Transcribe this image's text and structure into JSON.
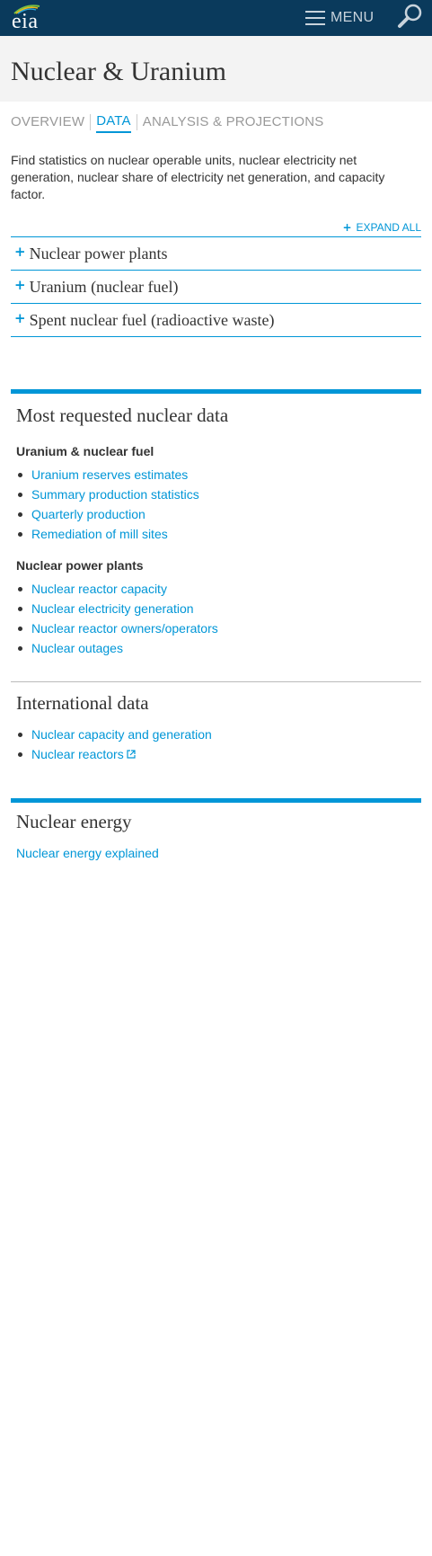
{
  "header": {
    "logo_text": "eia",
    "menu_label": "MENU",
    "search_icon": "search-icon",
    "menu_icon": "hamburger-icon",
    "colors": {
      "bar": "#0a3a5c",
      "accent": "#0096d7"
    }
  },
  "page": {
    "title": "Nuclear & Uranium"
  },
  "tabs": [
    {
      "label": "OVERVIEW",
      "active": false
    },
    {
      "label": "DATA",
      "active": true
    },
    {
      "label": "ANALYSIS & PROJECTIONS",
      "active": false
    }
  ],
  "intro": "Find statistics on nuclear operable units, nuclear electricity net generation, nuclear share of electricity net generation, and capacity factor.",
  "expand_all": "EXPAND ALL",
  "accordion": [
    {
      "label": "Nuclear power plants"
    },
    {
      "label": "Uranium (nuclear fuel)"
    },
    {
      "label": "Spent nuclear fuel (radioactive waste)"
    }
  ],
  "most_requested": {
    "title": "Most requested nuclear data",
    "groups": [
      {
        "heading": "Uranium & nuclear fuel",
        "links": [
          "Uranium reserves estimates",
          "Summary production statistics",
          "Quarterly production",
          "Remediation of mill sites"
        ]
      },
      {
        "heading": "Nuclear power plants",
        "links": [
          "Nuclear reactor capacity",
          "Nuclear electricity generation",
          "Nuclear reactor owners/operators",
          "Nuclear outages"
        ]
      }
    ]
  },
  "international": {
    "title": "International data",
    "links": [
      "Nuclear capacity and generation",
      "Nuclear reactors"
    ]
  },
  "nuclear_energy": {
    "title": "Nuclear energy",
    "link": "Nuclear energy explained"
  }
}
